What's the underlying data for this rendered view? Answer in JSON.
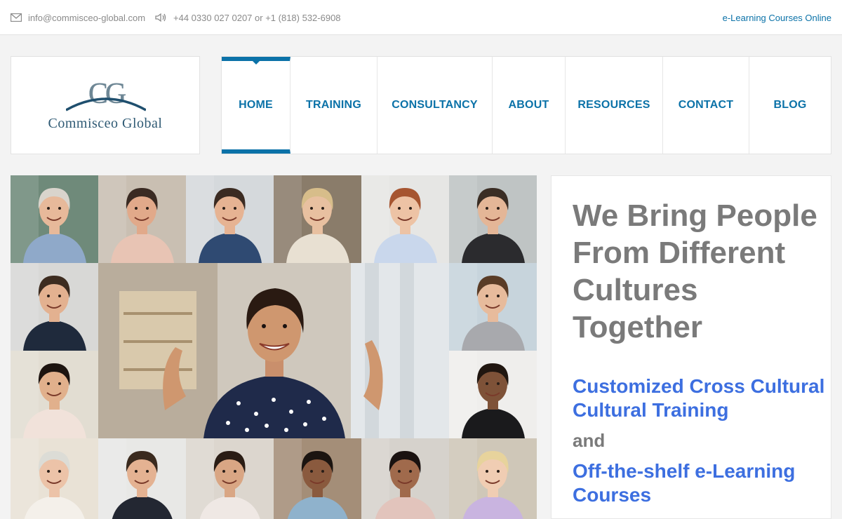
{
  "topbar": {
    "email": "info@commisceo-global.com",
    "email_icon": "envelope-icon",
    "phone": "+44 0330 027 0207 or +1 (818) 532-6908",
    "phone_icon": "speaker-icon",
    "right_link": "e-Learning Courses Online"
  },
  "logo": {
    "mark": "CG",
    "text": "Commisceo Global"
  },
  "nav": {
    "items": [
      {
        "label": "HOME"
      },
      {
        "label": "TRAINING"
      },
      {
        "label": "CONSULTANCY"
      },
      {
        "label": "ABOUT"
      },
      {
        "label": "RESOURCES"
      },
      {
        "label": "CONTACT"
      },
      {
        "label": "BLOG"
      }
    ],
    "active_index": 0
  },
  "hero": {
    "headline": "We Bring People From Different Cultures Together",
    "subline1": "Customized Cross Cultural Cultural Training",
    "connector": "and",
    "subline2": "Off-the-shelf e-Learning Courses"
  },
  "colors": {
    "accent": "#0b72a8",
    "headline": "#7a7a7a",
    "subline": "#3d6fe0"
  }
}
